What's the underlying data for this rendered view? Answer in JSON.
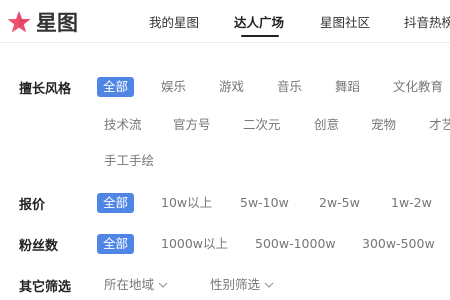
{
  "header": {
    "logo_text": "星图",
    "nav": [
      {
        "label": "我的星图",
        "active": false
      },
      {
        "label": "达人广场",
        "active": true
      },
      {
        "label": "星图社区",
        "active": false
      },
      {
        "label": "抖音热榜",
        "active": false
      }
    ]
  },
  "filters": {
    "style": {
      "label": "擅长风格",
      "options": [
        "全部",
        "娱乐",
        "游戏",
        "音乐",
        "舞蹈",
        "文化教育",
        "技术流",
        "官方号",
        "二次元",
        "创意",
        "宠物",
        "才艺",
        "手工手绘"
      ],
      "selected": "全部"
    },
    "price": {
      "label": "报价",
      "options": [
        "全部",
        "10w以上",
        "5w-10w",
        "2w-5w",
        "1w-2w"
      ],
      "selected": "全部"
    },
    "fans": {
      "label": "粉丝数",
      "options": [
        "全部",
        "1000w以上",
        "500w-1000w",
        "300w-500w"
      ],
      "selected": "全部"
    },
    "other": {
      "label": "其它筛选",
      "dropdowns": [
        "所在地域",
        "性别筛选"
      ]
    }
  },
  "colors": {
    "accent": "#4f86e6",
    "logo_pink": "#f0506e",
    "text_primary": "#222222",
    "text_muted": "#777777"
  }
}
